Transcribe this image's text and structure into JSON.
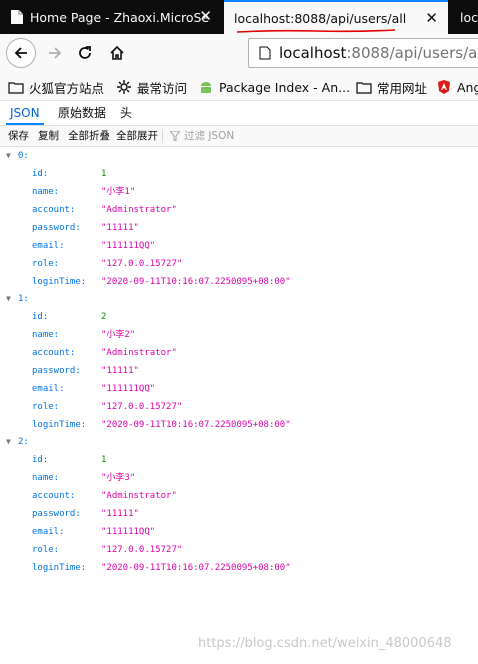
{
  "tabs": [
    {
      "title": "Home Page - Zhaoxi.MicroSe",
      "close": "✕"
    },
    {
      "title": "localhost:8088/api/users/all",
      "close": "✕"
    },
    {
      "title": "loc",
      "close": ""
    }
  ],
  "nav": {
    "url_host": "localhost",
    "url_rest": ":8088/api/users/all"
  },
  "bookmarks": [
    {
      "label": "火狐官方站点",
      "icon": "folder-icon"
    },
    {
      "label": "最常访问",
      "icon": "gear-icon"
    },
    {
      "label": "Package Index - An...",
      "icon": "android-icon"
    },
    {
      "label": "常用网址",
      "icon": "folder-icon"
    },
    {
      "label": "Ang",
      "icon": "angular-icon"
    }
  ],
  "viewer": {
    "tabs": [
      "JSON",
      "原始数据",
      "头"
    ],
    "toolbar": [
      "保存",
      "复制",
      "全部折叠",
      "全部展开"
    ],
    "filter_placeholder": "过滤 JSON"
  },
  "records": [
    {
      "index": "0:",
      "fields": [
        {
          "key": "id:",
          "value": "1",
          "type": "num"
        },
        {
          "key": "name:",
          "value": "\"小李1\"",
          "type": "str"
        },
        {
          "key": "account:",
          "value": "\"Adminstrator\"",
          "type": "str"
        },
        {
          "key": "password:",
          "value": "\"11111\"",
          "type": "str"
        },
        {
          "key": "email:",
          "value": "\"111111QQ\"",
          "type": "str"
        },
        {
          "key": "role:",
          "value": "\"127.0.0.15727\"",
          "type": "str"
        },
        {
          "key": "loginTime:",
          "value": "\"2020-09-11T10:16:07.2250095+08:00\"",
          "type": "str"
        }
      ]
    },
    {
      "index": "1:",
      "fields": [
        {
          "key": "id:",
          "value": "2",
          "type": "num"
        },
        {
          "key": "name:",
          "value": "\"小李2\"",
          "type": "str"
        },
        {
          "key": "account:",
          "value": "\"Adminstrator\"",
          "type": "str"
        },
        {
          "key": "password:",
          "value": "\"11111\"",
          "type": "str"
        },
        {
          "key": "email:",
          "value": "\"111111QQ\"",
          "type": "str"
        },
        {
          "key": "role:",
          "value": "\"127.0.0.15727\"",
          "type": "str"
        },
        {
          "key": "loginTime:",
          "value": "\"2020-09-11T10:16:07.2250095+08:00\"",
          "type": "str"
        }
      ]
    },
    {
      "index": "2:",
      "fields": [
        {
          "key": "id:",
          "value": "1",
          "type": "num"
        },
        {
          "key": "name:",
          "value": "\"小李3\"",
          "type": "str"
        },
        {
          "key": "account:",
          "value": "\"Adminstrator\"",
          "type": "str"
        },
        {
          "key": "password:",
          "value": "\"11111\"",
          "type": "str"
        },
        {
          "key": "email:",
          "value": "\"111111QQ\"",
          "type": "str"
        },
        {
          "key": "role:",
          "value": "\"127.0.0.15727\"",
          "type": "str"
        },
        {
          "key": "loginTime:",
          "value": "\"2020-09-11T10:16:07.2250095+08:00\"",
          "type": "str"
        }
      ]
    }
  ],
  "watermark": "https://blog.csdn.net/weixin_48000648",
  "colors": {
    "accent": "#0a84ff",
    "annotation": "#e00000",
    "json_key": "#0074e8",
    "json_string": "#dd00a9",
    "json_number": "#058b00"
  }
}
